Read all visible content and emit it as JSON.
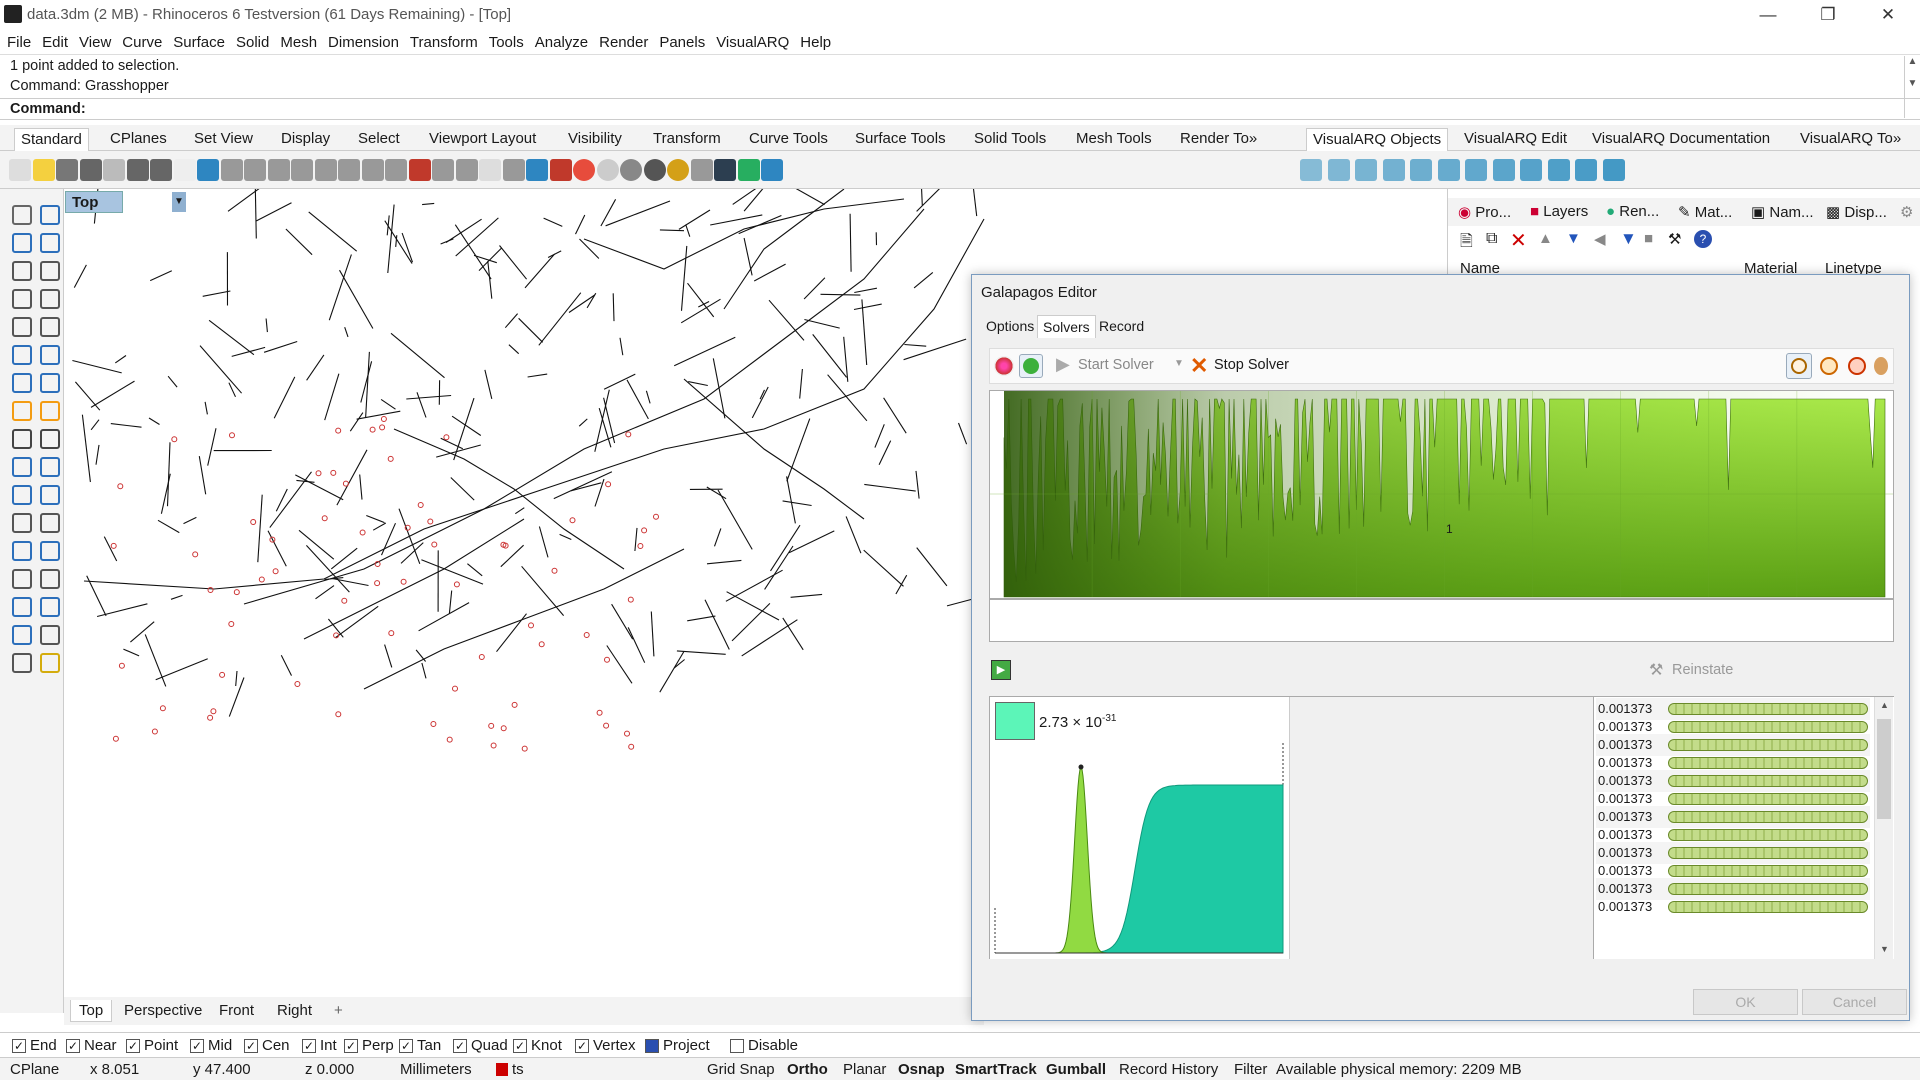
{
  "window": {
    "title": "data.3dm (2 MB) - Rhinoceros 6 Testversion (61 Days Remaining) - [Top]"
  },
  "menu": [
    "File",
    "Edit",
    "View",
    "Curve",
    "Surface",
    "Solid",
    "Mesh",
    "Dimension",
    "Transform",
    "Tools",
    "Analyze",
    "Render",
    "Panels",
    "VisualARQ",
    "Help"
  ],
  "command": {
    "history": [
      "1 point added to selection.",
      "Command: Grasshopper"
    ],
    "prompt": "Command:"
  },
  "toolbar_tabs": [
    "Standard",
    "CPlanes",
    "Set View",
    "Display",
    "Select",
    "Viewport Layout",
    "Visibility",
    "Transform",
    "Curve Tools",
    "Surface Tools",
    "Solid Tools",
    "Mesh Tools",
    "Render To»"
  ],
  "right_toolbar_tabs": [
    "VisualARQ Objects",
    "VisualARQ Edit",
    "VisualARQ Documentation",
    "VisualARQ To»"
  ],
  "viewport": {
    "label": "Top"
  },
  "view_tabs": [
    "Top",
    "Perspective",
    "Front",
    "Right"
  ],
  "osnaps": [
    {
      "label": "End",
      "checked": true
    },
    {
      "label": "Near",
      "checked": true
    },
    {
      "label": "Point",
      "checked": true
    },
    {
      "label": "Mid",
      "checked": true
    },
    {
      "label": "Cen",
      "checked": true
    },
    {
      "label": "Int",
      "checked": true
    },
    {
      "label": "Perp",
      "checked": true
    },
    {
      "label": "Tan",
      "checked": true
    },
    {
      "label": "Quad",
      "checked": true
    },
    {
      "label": "Knot",
      "checked": true
    },
    {
      "label": "Vertex",
      "checked": true
    },
    {
      "label": "Project",
      "checked": false
    },
    {
      "label": "Disable",
      "checked": false
    }
  ],
  "status": {
    "cplane": "CPlane",
    "x": "x 8.051",
    "y": "y 47.400",
    "z": "z 0.000",
    "units": "Millimeters",
    "layer": "ts",
    "grid_snap": "Grid Snap",
    "ortho": "Ortho",
    "planar": "Planar",
    "osnap": "Osnap",
    "smarttrack": "SmartTrack",
    "gumball": "Gumball",
    "record_history": "Record History",
    "filter": "Filter",
    "memory": "Available physical memory: 2209 MB",
    "layer_color": "#cc0000"
  },
  "right_panel": {
    "tabs": [
      "Pro...",
      "Layers",
      "Ren...",
      "Mat...",
      "Nam...",
      "Disp..."
    ],
    "columns": [
      "Name",
      "Material",
      "Linetype"
    ]
  },
  "galapagos": {
    "title": "Galapagos Editor",
    "tabs": [
      "Options",
      "Solvers",
      "Record"
    ],
    "start_solver": "Start Solver",
    "stop_solver": "Stop Solver",
    "chart_axis_label": "1",
    "reinstate": "Reinstate",
    "fitness_display": "2.73 × 10",
    "fitness_exponent": "-31",
    "genomes": [
      "0.001373",
      "0.001373",
      "0.001373",
      "0.001373",
      "0.001373",
      "0.001373",
      "0.001373",
      "0.001373",
      "0.001373",
      "0.001373",
      "0.001373",
      "0.001373"
    ],
    "ok": "OK",
    "cancel": "Cancel"
  },
  "colors": {
    "accent": "#7ed321",
    "chart_light": "#a9e84a",
    "chart_dark": "#3c6b0e",
    "dist_teal": "#1ec9a4",
    "swatch": "#5cf5b8"
  }
}
